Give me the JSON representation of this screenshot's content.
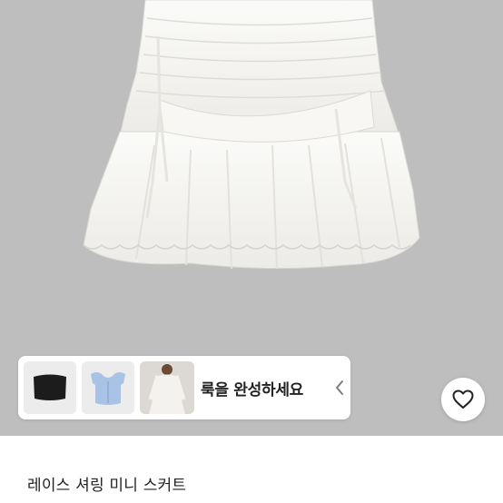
{
  "look_banner": {
    "text": "룩을 완성하세요",
    "thumbnails": [
      {
        "icon": "black-tube-top-icon",
        "color": "#1c1c1c"
      },
      {
        "icon": "blue-crop-top-icon",
        "color": "#a9c3e6"
      },
      {
        "icon": "white-dress-model-icon",
        "color": "#f4f2ef"
      }
    ],
    "chevron_icon": "chevron-left-icon"
  },
  "wishlist": {
    "icon": "heart-outline-icon"
  },
  "product": {
    "title": "레이스 셔링 미니 스커트"
  },
  "colors": {
    "hero_background": "#bebebe",
    "skirt": "#f6f5f2",
    "text_primary": "#222222"
  }
}
